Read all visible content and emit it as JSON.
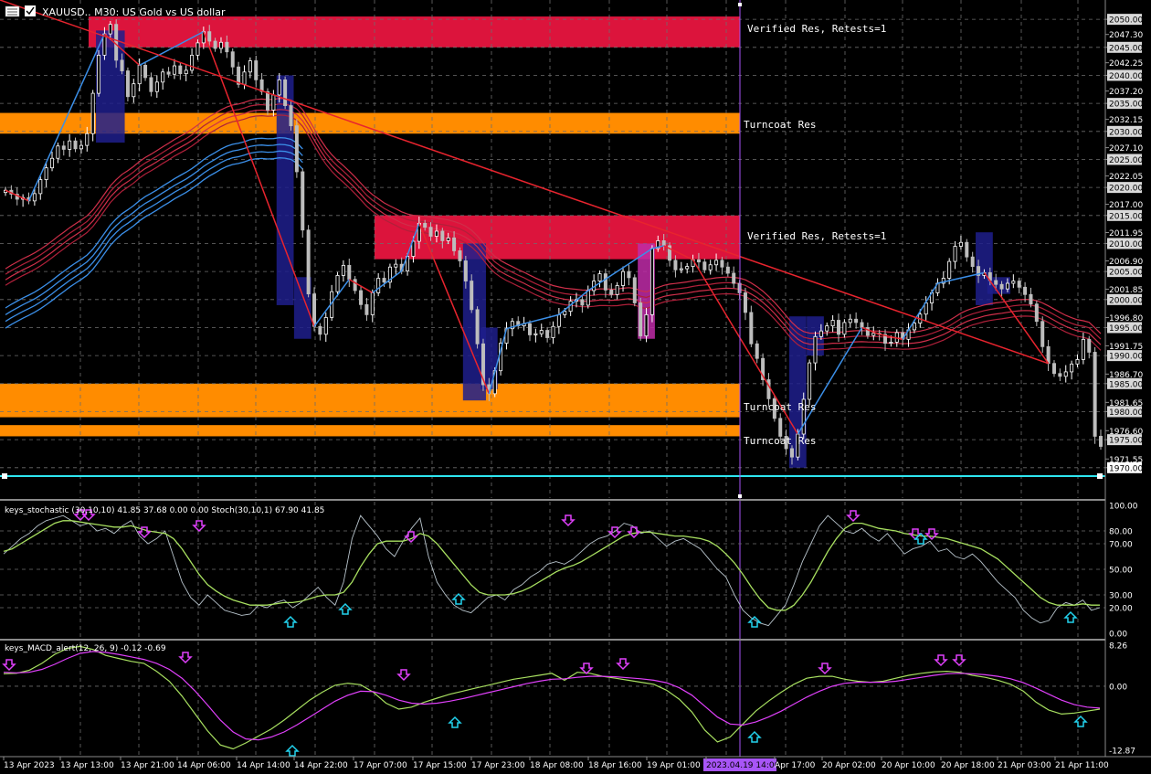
{
  "header": {
    "title": "XAUUSD.. M30: US Gold vs US dollar",
    "icon": "window-menu-icon",
    "symbol_box_icon": "symbol-box-icon"
  },
  "colors": {
    "background": "#000000",
    "grid": "#6d6d6d",
    "bull_candle": "#ffffff",
    "bear_candle": "#bdbdbd",
    "up_leg": "#3b8fe8",
    "down_leg": "#e8242e",
    "resistance_zone": "#dc143c",
    "turncoat_zone": "#ff8c00",
    "support_line": "#2ee6f0",
    "sell_arrow": "#e040fb",
    "buy_arrow": "#22d3ee",
    "stoch_fast": "#b8c4cc",
    "stoch_slow": "#a8e060",
    "macd_main": "#a8e060",
    "macd_signal": "#e040fb",
    "crosshair": "#a855f7",
    "volatility_box": "#1e1e8c"
  },
  "main_panel": {
    "y_axis_labels": [
      "2050.00",
      "2047.30",
      "2045.00",
      "2042.25",
      "2040.00",
      "2037.20",
      "2035.00",
      "2032.15",
      "2030.00",
      "2027.10",
      "2025.00",
      "2022.05",
      "2020.00",
      "2017.00",
      "2015.00",
      "2011.95",
      "2010.00",
      "2006.90",
      "2005.00",
      "2001.85",
      "2000.00",
      "1996.80",
      "1995.00",
      "1991.75",
      "1990.00",
      "1986.70",
      "1985.00",
      "1981.65",
      "1980.00",
      "1976.60",
      "1975.00",
      "1971.55",
      "1970.00"
    ],
    "highlighted_labels": [
      "2050.00",
      "2045.00",
      "2040.00",
      "2035.00",
      "2030.00",
      "2025.00",
      "2020.00",
      "2015.00",
      "2010.00",
      "2005.00",
      "2000.00",
      "1995.00",
      "1990.00",
      "1985.00",
      "1980.00",
      "1975.00",
      "1970.00"
    ],
    "current_price_label": "1970.00",
    "zone_labels": {
      "verified_res_1": "Verified Res, Retests=1",
      "turncoat_res_1": "Turncoat Res",
      "verified_res_2": "Verified Res, Retests=1",
      "turncoat_res_2": "Turncoat Res",
      "turncoat_res_3": "Turncoat Res"
    }
  },
  "stochastic_panel": {
    "title": "keys_stochastic (30,10,10) 41.85 37.68 0.00 0.00 Stoch(30,10,1) 67.90 41.85",
    "y_axis_labels": [
      "100.00",
      "80.00",
      "70.00",
      "50.00",
      "30.00",
      "20.00",
      "0.00"
    ]
  },
  "macd_panel": {
    "title": "keys_MACD_alert(12, 26, 9) -0.12 -0.69",
    "y_axis_labels": [
      "8.26",
      "0.00",
      "-12.87"
    ]
  },
  "x_axis": {
    "labels": [
      "13 Apr 2023",
      "13 Apr 13:00",
      "13 Apr 21:00",
      "14 Apr 06:00",
      "14 Apr 14:00",
      "14 Apr 22:00",
      "17 Apr 07:00",
      "17 Apr 15:00",
      "17 Apr 23:00",
      "18 Apr 08:00",
      "18 Apr 16:00",
      "19 Apr 01:00",
      "2023.04.19 14:00",
      "Apr 17:00",
      "20 Apr 02:00",
      "20 Apr 10:00",
      "20 Apr 18:00",
      "21 Apr 03:00",
      "21 Apr 11:00"
    ],
    "crosshair_label": "2023.04.19 14:00"
  },
  "chart_data": [
    {
      "type": "line",
      "title": "XAUUSD.. M30: US Gold vs US dollar",
      "panel": "price",
      "ylim": [
        1968.5,
        2051.0
      ],
      "grid": true,
      "x_labels": [
        "13 Apr 2023",
        "13 Apr 13:00",
        "13 Apr 21:00",
        "14 Apr 06:00",
        "14 Apr 14:00",
        "14 Apr 22:00",
        "17 Apr 07:00",
        "17 Apr 15:00",
        "17 Apr 23:00",
        "18 Apr 08:00",
        "18 Apr 16:00",
        "19 Apr 01:00",
        "2023.04.19 14:00",
        "Apr 17:00",
        "20 Apr 02:00",
        "20 Apr 10:00",
        "20 Apr 18:00",
        "21 Apr 03:00",
        "21 Apr 11:00"
      ],
      "close_series": [
        2019.5,
        2018.8,
        2017.9,
        2018.2,
        2017.6,
        2018.9,
        2021.4,
        2023.5,
        2025.2,
        2027.4,
        2026.8,
        2028.3,
        2026.9,
        2027.5,
        2029.6,
        2036.8,
        2043.6,
        2047.4,
        2049.1,
        2042.7,
        2040.8,
        2036.2,
        2038.5,
        2041.8,
        2039.6,
        2037.1,
        2038.8,
        2040.6,
        2040.2,
        2041.7,
        2040.3,
        2040.9,
        2043.6,
        2045.8,
        2047.8,
        2046.1,
        2044.8,
        2045.9,
        2044.2,
        2041.5,
        2038.4,
        2040.6,
        2042.6,
        2039.2,
        2037.1,
        2033.8,
        2036.5,
        2039.2,
        2034.6,
        2031.0,
        2022.8,
        2012.4,
        2001.0,
        1995.2,
        1993.8,
        1996.8,
        2001.4,
        2004.3,
        2006.1,
        2003.6,
        2001.6,
        1999.1,
        1997.3,
        2001.2,
        2003.8,
        2003.1,
        2005.8,
        2006.3,
        2005.1,
        2007.7,
        2010.4,
        2013.6,
        2012.9,
        2011.3,
        2012.2,
        2010.5,
        2011.0,
        2008.7,
        2006.9,
        2003.3,
        1998.2,
        1992.1,
        1984.8,
        1983.2,
        1987.3,
        1992.2,
        1994.8,
        1996.1,
        1995.3,
        1995.7,
        1993.7,
        1993.9,
        1994.5,
        1993.2,
        1995.2,
        1997.3,
        1997.9,
        1999.7,
        2000.0,
        1999.0,
        2001.6,
        2003.3,
        2004.6,
        2001.7,
        2000.9,
        2002.5,
        2005.0,
        2003.9,
        1999.4,
        1993.5,
        1997.3,
        2009.1,
        2010.5,
        2009.6,
        2007.0,
        2005.3,
        2005.5,
        2005.9,
        2007.1,
        2006.7,
        2005.3,
        2006.2,
        2007.0,
        2005.8,
        2004.7,
        2002.9,
        2001.2,
        1997.7,
        1992.1,
        1989.5,
        1985.7,
        1982.3,
        1978.8,
        1975.6,
        1973.4,
        1971.9,
        1976.0,
        1982.2,
        1988.7,
        1993.4,
        1994.4,
        1995.3,
        1996.3,
        1993.8,
        1995.9,
        1996.5,
        1995.9,
        1995.0,
        1993.6,
        1994.0,
        1993.8,
        1992.2,
        1992.4,
        1994.1,
        1992.9,
        1994.6,
        1995.8,
        1997.4,
        1999.4,
        2001.2,
        2002.9,
        2003.8,
        2006.8,
        2009.5,
        2010.2,
        2007.6,
        2005.9,
        2004.3,
        2004.8,
        2003.4,
        2002.7,
        2001.9,
        2002.9,
        2003.3,
        2002.2,
        2000.9,
        1999.2,
        1996.1,
        1991.6,
        1988.6,
        1986.8,
        1986.3,
        1987.1,
        1988.5,
        1989.3,
        1992.9,
        1990.6,
        1975.6,
        1973.8
      ],
      "zones": [
        {
          "label": "Verified Res, Retests=1",
          "from": 2045.0,
          "to": 2050.5
        },
        {
          "label": "Turncoat Res",
          "from": 2029.6,
          "to": 2033.3
        },
        {
          "label": "Verified Res, Retests=1",
          "from": 2007.2,
          "to": 2015.0
        },
        {
          "label": "Turncoat Res",
          "from": 1979.0,
          "to": 1985.0
        },
        {
          "label": "Turncoat Res",
          "from": 1975.6,
          "to": 1977.6
        }
      ],
      "support_level": 1970.0,
      "current_price": 1970.0
    },
    {
      "type": "line",
      "title": "keys_stochastic (30,10,10) 41.85 37.68 0.00 0.00 Stoch(30,10,1) 67.90 41.85",
      "panel": "stochastic",
      "ylim": [
        0,
        100
      ],
      "levels": [
        20,
        30,
        50,
        70,
        80
      ],
      "series": [
        {
          "values": [
            62,
            68,
            74,
            78,
            84,
            88,
            90,
            92,
            88,
            84,
            86,
            80,
            82,
            78,
            84,
            88,
            76,
            70,
            74,
            80,
            60,
            40,
            28,
            22,
            30,
            24,
            18,
            16,
            14,
            15,
            22,
            20,
            24,
            26,
            20,
            24,
            30,
            36,
            28,
            22,
            40,
            74,
            92,
            84,
            76,
            66,
            60,
            72,
            82,
            90,
            60,
            40,
            30,
            22,
            18,
            16,
            22,
            28,
            30,
            26,
            34,
            38,
            44,
            48,
            54,
            56,
            54,
            58,
            64,
            70,
            74,
            76,
            80,
            86,
            84,
            78,
            80,
            74,
            68,
            72,
            74,
            70,
            66,
            58,
            50,
            44,
            30,
            18,
            12,
            8,
            6,
            14,
            22,
            38,
            56,
            70,
            84,
            92,
            86,
            80,
            78,
            82,
            76,
            72,
            78,
            70,
            62,
            66,
            68,
            72,
            64,
            66,
            60,
            58,
            62,
            56,
            48,
            40,
            34,
            28,
            18,
            12,
            8,
            10,
            20,
            24,
            22,
            26,
            18,
            20
          ]
        },
        {
          "values": [
            64,
            66,
            70,
            74,
            78,
            82,
            86,
            88,
            88,
            87,
            86,
            85,
            84,
            83,
            83,
            84,
            82,
            80,
            79,
            78,
            74,
            66,
            56,
            46,
            38,
            33,
            29,
            26,
            24,
            22,
            22,
            22,
            23,
            24,
            24,
            25,
            27,
            29,
            30,
            30,
            32,
            40,
            52,
            62,
            70,
            72,
            72,
            72,
            74,
            78,
            76,
            70,
            62,
            54,
            46,
            38,
            32,
            30,
            30,
            30,
            31,
            33,
            36,
            40,
            44,
            48,
            51,
            53,
            56,
            60,
            64,
            68,
            72,
            76,
            78,
            79,
            79,
            78,
            77,
            76,
            76,
            75,
            74,
            72,
            68,
            62,
            55,
            46,
            36,
            27,
            20,
            18,
            18,
            22,
            30,
            40,
            52,
            64,
            74,
            82,
            86,
            86,
            84,
            82,
            81,
            80,
            78,
            77,
            76,
            76,
            75,
            74,
            72,
            70,
            68,
            66,
            62,
            58,
            52,
            46,
            40,
            34,
            28,
            24,
            22,
            22,
            22,
            23,
            22,
            22
          ]
        }
      ],
      "sell_signals": 11,
      "buy_signals": 6
    },
    {
      "type": "line",
      "title": "keys_MACD_alert(12, 26, 9) -0.12 -0.69",
      "panel": "macd",
      "ylim": [
        -12.87,
        8.26
      ],
      "series": [
        {
          "values": [
            2.5,
            2.6,
            3.2,
            4.6,
            6.4,
            7.6,
            8.0,
            7.4,
            6.2,
            5.6,
            5.0,
            4.6,
            3.0,
            1.0,
            -2.0,
            -5.5,
            -9.0,
            -11.8,
            -12.6,
            -11.4,
            -10.0,
            -8.6,
            -6.8,
            -4.8,
            -2.8,
            -1.2,
            0.2,
            0.6,
            0.3,
            -1.2,
            -3.4,
            -4.6,
            -4.2,
            -3.2,
            -2.4,
            -1.6,
            -1.0,
            -0.4,
            0.2,
            0.8,
            1.4,
            1.8,
            2.2,
            2.6,
            1.2,
            2.8,
            2.6,
            2.0,
            1.6,
            1.2,
            0.8,
            0.4,
            -0.8,
            -2.6,
            -5.2,
            -8.8,
            -11.2,
            -10.2,
            -7.6,
            -5.0,
            -3.0,
            -1.2,
            0.4,
            1.6,
            2.0,
            2.0,
            1.4,
            1.0,
            0.8,
            1.0,
            1.6,
            2.2,
            2.6,
            2.9,
            3.0,
            2.8,
            2.2,
            1.8,
            1.2,
            0.4,
            -1.0,
            -3.2,
            -4.8,
            -5.6,
            -5.4,
            -5.0,
            -4.6
          ]
        },
        {
          "values": [
            2.8,
            2.7,
            2.8,
            3.4,
            4.4,
            5.6,
            6.6,
            7.0,
            6.8,
            6.4,
            5.9,
            5.4,
            4.6,
            3.4,
            1.6,
            -0.9,
            -3.8,
            -6.8,
            -9.2,
            -10.6,
            -10.8,
            -10.2,
            -9.2,
            -7.8,
            -6.2,
            -4.6,
            -3.0,
            -1.8,
            -1.0,
            -1.1,
            -1.8,
            -2.8,
            -3.4,
            -3.6,
            -3.4,
            -3.0,
            -2.5,
            -1.9,
            -1.3,
            -0.7,
            -0.1,
            0.5,
            1.0,
            1.4,
            1.5,
            1.8,
            2.0,
            2.0,
            1.9,
            1.7,
            1.5,
            1.2,
            0.7,
            -0.3,
            -1.8,
            -4.0,
            -6.2,
            -7.6,
            -7.8,
            -7.2,
            -6.2,
            -5.0,
            -3.6,
            -2.2,
            -1.0,
            0.0,
            0.6,
            0.8,
            0.8,
            0.8,
            1.0,
            1.4,
            1.8,
            2.2,
            2.5,
            2.6,
            2.5,
            2.3,
            2.0,
            1.5,
            0.7,
            -0.4,
            -1.6,
            -2.8,
            -3.7,
            -4.2,
            -4.4
          ]
        }
      ],
      "sell_signals": 8,
      "buy_signals": 4
    }
  ]
}
